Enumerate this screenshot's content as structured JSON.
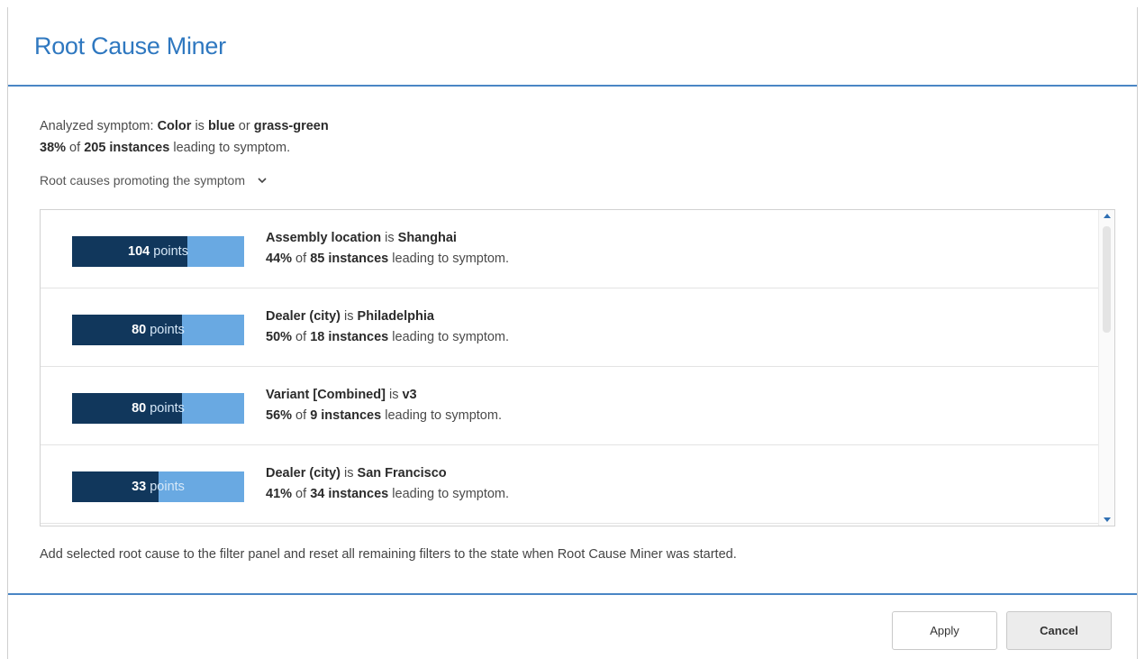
{
  "dialog": {
    "title": "Root Cause Miner"
  },
  "summary": {
    "line1_prefix": "Analyzed symptom: ",
    "column": "Color",
    "is": " is ",
    "value1": "blue",
    "or": " or ",
    "value2": "grass-green",
    "pct": "38%",
    "of": " of ",
    "instances": "205 instances",
    "suffix": " leading to symptom."
  },
  "section": {
    "label": "Root causes promoting the symptom",
    "icon": "chevron-down-icon"
  },
  "root_causes": [
    {
      "points": "104",
      "points_label": "points",
      "score_fraction": 0.67,
      "column": "Assembly location",
      "connector": " is ",
      "value": "Shanghai",
      "pct": "44%",
      "of": " of ",
      "instances": "85 instances",
      "suffix": " leading to symptom."
    },
    {
      "points": "80",
      "points_label": "points",
      "score_fraction": 0.64,
      "column": "Dealer (city)",
      "connector": " is ",
      "value": "Philadelphia",
      "pct": "50%",
      "of": " of ",
      "instances": "18 instances",
      "suffix": " leading to symptom."
    },
    {
      "points": "80",
      "points_label": "points",
      "score_fraction": 0.64,
      "column": "Variant [Combined]",
      "connector": " is ",
      "value": "v3",
      "pct": "56%",
      "of": " of ",
      "instances": "9 instances",
      "suffix": " leading to symptom."
    },
    {
      "points": "33",
      "points_label": "points",
      "score_fraction": 0.5,
      "column": "Dealer (city)",
      "connector": " is ",
      "value": "San Francisco",
      "pct": "41%",
      "of": " of ",
      "instances": "34 instances",
      "suffix": " leading to symptom."
    }
  ],
  "note": "Add selected root cause to the filter panel and reset all remaining filters to the state when Root Cause Miner was started.",
  "buttons": {
    "apply": "Apply",
    "cancel": "Cancel"
  },
  "colors": {
    "accent": "#2f78c0",
    "bar_dark": "#11375c",
    "bar_light": "#69a9e2"
  }
}
